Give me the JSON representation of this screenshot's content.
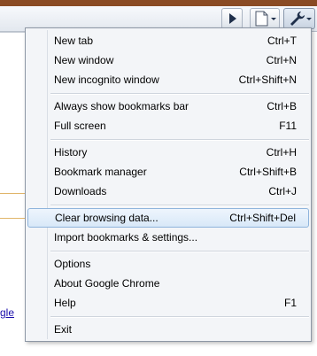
{
  "page": {
    "link_fragment": "gle"
  },
  "menu": {
    "items": [
      {
        "label": "New tab",
        "shortcut": "Ctrl+T"
      },
      {
        "label": "New window",
        "shortcut": "Ctrl+N"
      },
      {
        "label": "New incognito window",
        "shortcut": "Ctrl+Shift+N"
      },
      {
        "label": "Always show bookmarks bar",
        "shortcut": "Ctrl+B"
      },
      {
        "label": "Full screen",
        "shortcut": "F11"
      },
      {
        "label": "History",
        "shortcut": "Ctrl+H"
      },
      {
        "label": "Bookmark manager",
        "shortcut": "Ctrl+Shift+B"
      },
      {
        "label": "Downloads",
        "shortcut": "Ctrl+J"
      },
      {
        "label": "Clear browsing data...",
        "shortcut": "Ctrl+Shift+Del",
        "highlighted": true
      },
      {
        "label": "Import bookmarks & settings...",
        "shortcut": ""
      },
      {
        "label": "Options",
        "shortcut": ""
      },
      {
        "label": "About Google Chrome",
        "shortcut": ""
      },
      {
        "label": "Help",
        "shortcut": "F1"
      },
      {
        "label": "Exit",
        "shortcut": ""
      }
    ]
  },
  "toolbar": {
    "icons": [
      "play-icon",
      "page-menu-icon",
      "wrench-menu-icon"
    ]
  },
  "colors": {
    "highlight_border": "#8fb4dc",
    "menu_bg": "#f3f5f8",
    "link": "#1a0dab",
    "frame": "#8a4b24"
  }
}
